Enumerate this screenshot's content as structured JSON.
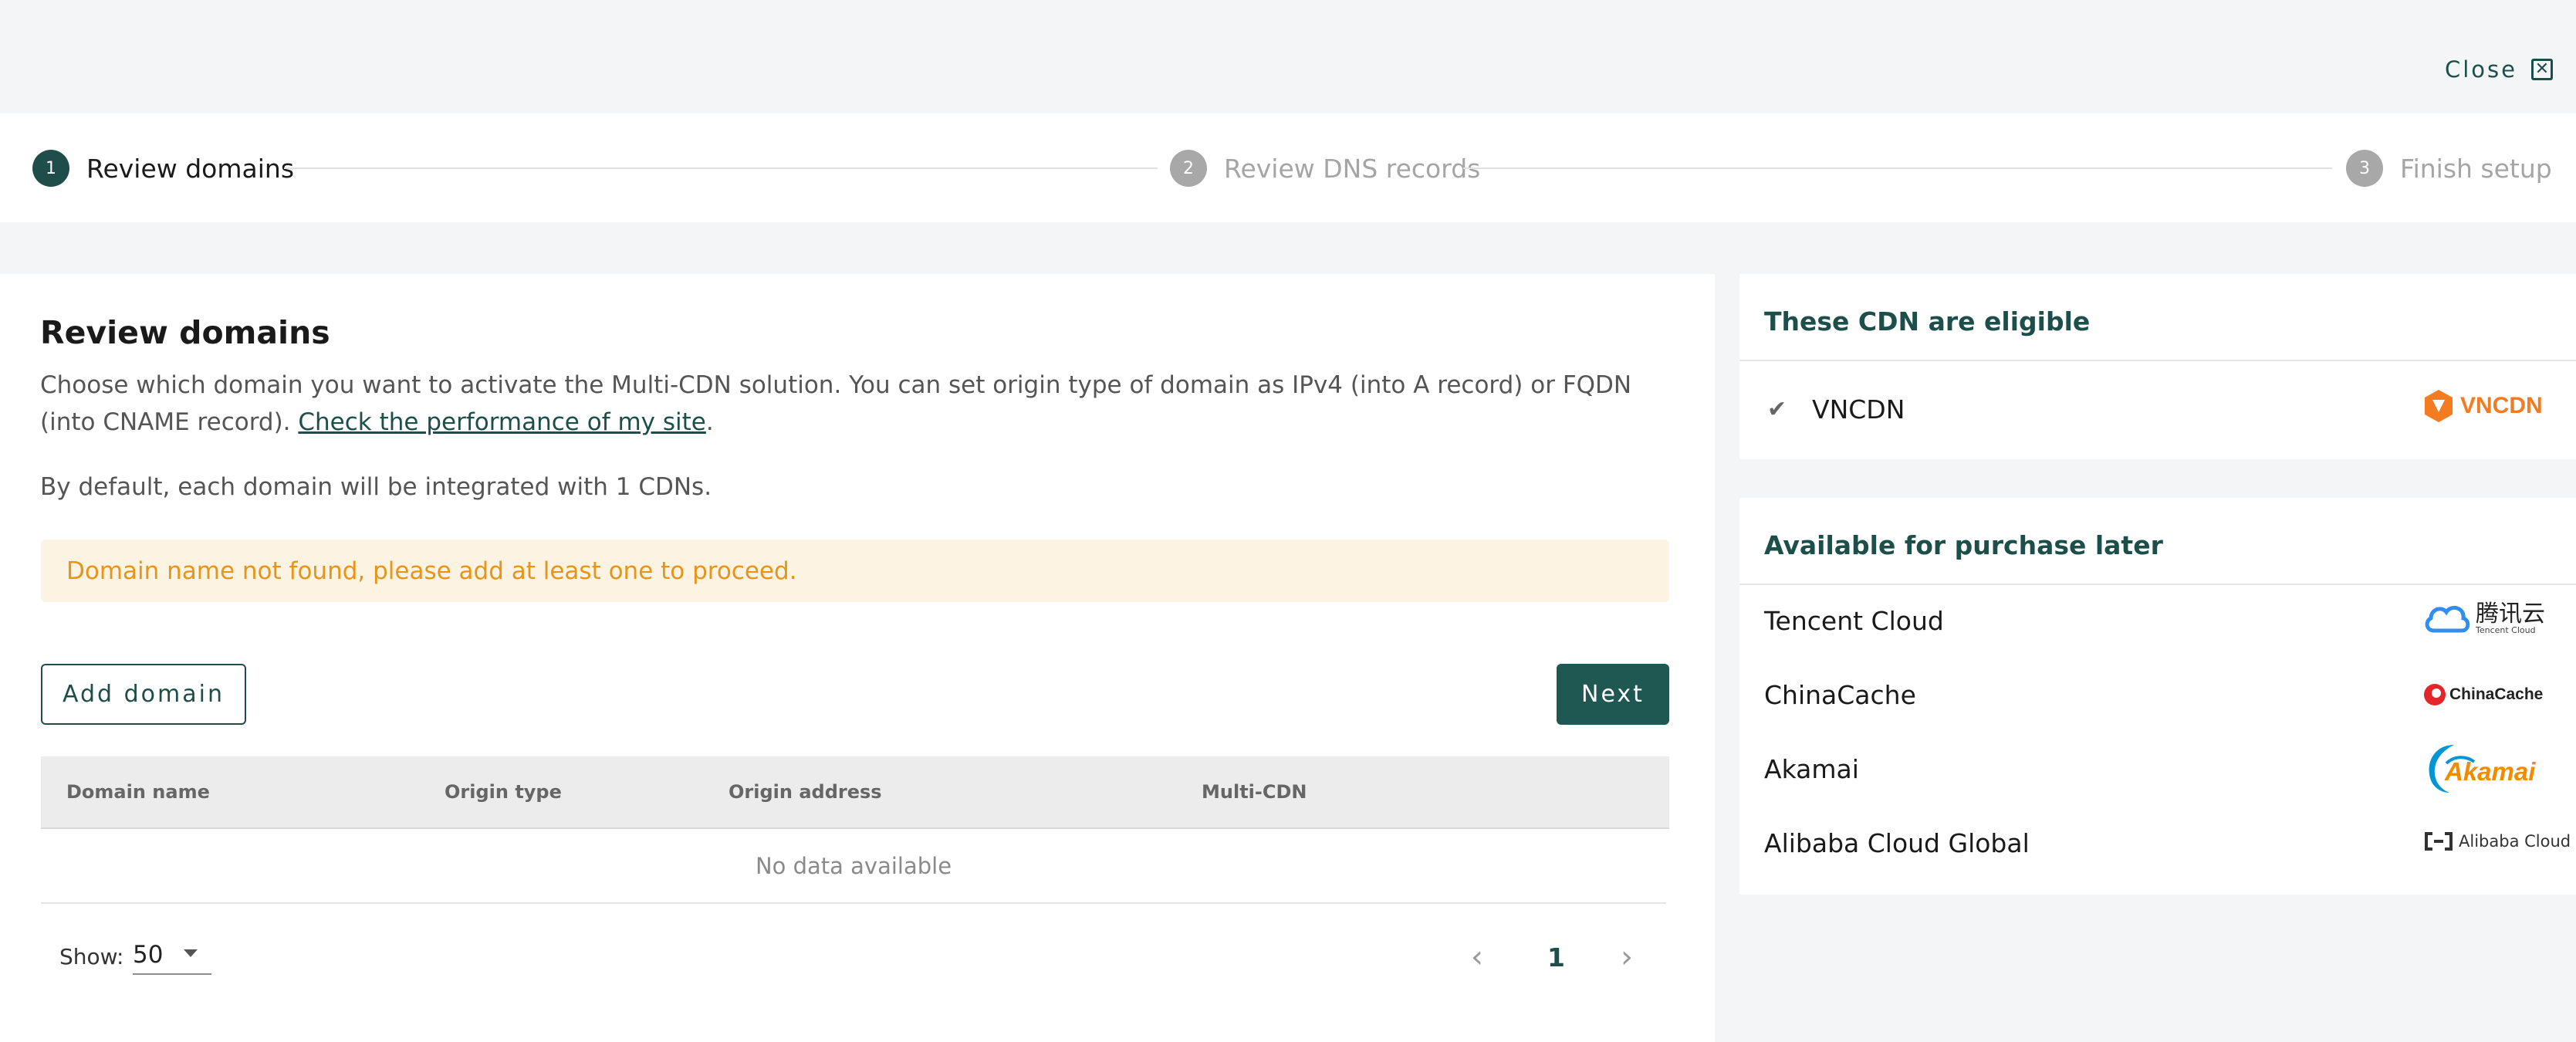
{
  "header": {
    "close_label": "Close",
    "close_icon_glyph": "✕"
  },
  "stepper": {
    "steps": [
      {
        "number": "1",
        "label": "Review domains",
        "state": "active"
      },
      {
        "number": "2",
        "label": "Review DNS records",
        "state": "todo"
      },
      {
        "number": "3",
        "label": "Finish setup",
        "state": "todo"
      }
    ]
  },
  "main": {
    "title": "Review domains",
    "description_pre": "Choose which domain you want to activate the Multi-CDN solution. You can set origin type of domain as IPv4 (into A record) or FQDN (into CNAME record). ",
    "description_link": "Check the performance of my site",
    "description_post": ".",
    "default_note": "By default, each domain will be integrated with 1 CDNs.",
    "alert": "Domain name not found, please add at least one to proceed.",
    "add_button": "Add domain",
    "next_button": "Next",
    "table": {
      "columns": [
        "Domain name",
        "Origin type",
        "Origin address",
        "Multi-CDN"
      ],
      "empty_text": "No data available"
    },
    "pagination": {
      "show_label": "Show:",
      "page_size": "50",
      "current_page": "1",
      "prev_glyph": "‹",
      "next_glyph": "›"
    }
  },
  "eligible": {
    "title": "These CDN are eligible",
    "items": [
      {
        "name": "VNCDN",
        "check_glyph": "✔",
        "logo_text": "VNCDN"
      }
    ]
  },
  "purchase_later": {
    "title": "Available for purchase later",
    "items": [
      {
        "name": "Tencent Cloud",
        "logo_text": "腾讯云",
        "logo_subtext": "Tencent Cloud"
      },
      {
        "name": "ChinaCache",
        "logo_text": "ChinaCache"
      },
      {
        "name": "Akamai",
        "logo_text": "Akamai"
      },
      {
        "name": "Alibaba Cloud Global",
        "logo_text": "Alibaba Cloud"
      }
    ]
  },
  "colors": {
    "brand": "#1f4d49",
    "alert_bg": "#fdf3e2",
    "alert_text": "#e6951a",
    "vncdn_orange": "#f47b20",
    "tencent_blue": "#2f8ef0",
    "chinacache_red": "#e3262a",
    "akamai_blue": "#0096d6",
    "akamai_orange": "#f38b00"
  }
}
